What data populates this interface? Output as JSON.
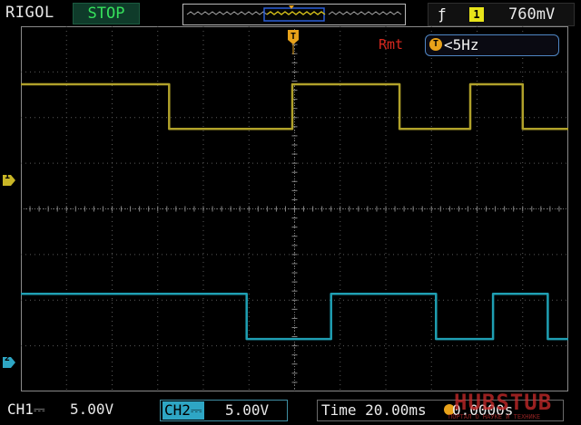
{
  "brand": "RIGOL",
  "run_state": "STOP",
  "trigger": {
    "edge_symbol": "ƒ",
    "source": "1",
    "level": "760mV"
  },
  "measure": {
    "mode": "Rmt",
    "badge": "T",
    "freq_value": "<5Hz"
  },
  "channels": {
    "ch1_marker": "1",
    "ch2_marker": "2",
    "ch1_label": "CH1",
    "ch1_coupling": "⎓",
    "ch1_scale": "5.00V",
    "ch2_label": "CH2",
    "ch2_coupling": "⎓",
    "ch2_scale": "5.00V"
  },
  "timebase": {
    "label": "Time 20.00ms",
    "offset": "0.0000s"
  },
  "watermark": {
    "text": "HUBSTUB",
    "sub": "ПОРТАЛ О НАУКЕ И ТЕХНИКЕ"
  },
  "colors": {
    "ch1": "#b0a12a",
    "ch2": "#1f9fb3",
    "stop_bg": "#0f3b2a",
    "stop_fg": "#36e15c",
    "grid": "#5a5a5a"
  },
  "chart_data": {
    "type": "line",
    "title": "",
    "xlabel": "",
    "ylabel": "",
    "x_divisions": 12,
    "y_divisions": 8,
    "series": [
      {
        "name": "CH1",
        "x": [
          0.0,
          3.25,
          3.25,
          5.95,
          5.95,
          8.3,
          8.3,
          9.85,
          9.85,
          11.0,
          11.0,
          12.0
        ],
        "values": [
          6.73,
          6.73,
          5.75,
          5.75,
          6.73,
          6.73,
          5.75,
          5.75,
          6.73,
          6.73,
          5.75,
          5.75
        ]
      },
      {
        "name": "CH2",
        "x": [
          0.0,
          4.95,
          4.95,
          6.8,
          6.8,
          9.1,
          9.1,
          10.35,
          10.35,
          11.55,
          11.55,
          12.0
        ],
        "values": [
          2.14,
          2.14,
          1.15,
          1.15,
          2.14,
          2.14,
          1.15,
          1.15,
          2.14,
          2.14,
          1.15,
          1.15
        ]
      }
    ]
  }
}
